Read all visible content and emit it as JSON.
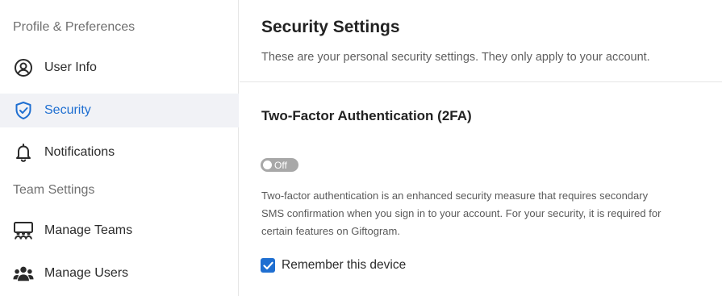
{
  "sidebar": {
    "sections": [
      {
        "label": "Profile & Preferences"
      },
      {
        "label": "Team Settings"
      }
    ],
    "items": [
      {
        "label": "User Info",
        "icon": "user-circle-icon"
      },
      {
        "label": "Security",
        "icon": "shield-check-icon",
        "active": true
      },
      {
        "label": "Notifications",
        "icon": "bell-icon"
      },
      {
        "label": "Manage Teams",
        "icon": "team-board-icon"
      },
      {
        "label": "Manage Users",
        "icon": "users-group-icon"
      }
    ]
  },
  "main": {
    "title": "Security Settings",
    "subtitle": "These are your personal security settings. They only apply to your account.",
    "two_factor": {
      "heading": "Two-Factor Authentication (2FA)",
      "toggle_label": "Off",
      "description": "Two-factor authentication is an enhanced security measure that requires secondary SMS confirmation when you sign in to your account. For your security, it is required for certain features on Giftogram."
    },
    "remember_device": {
      "label": "Remember this device",
      "checked": true
    }
  },
  "colors": {
    "accent": "#1f6fd1",
    "active_bg": "#f1f2f6",
    "toggle_off": "#a8a8a8"
  }
}
